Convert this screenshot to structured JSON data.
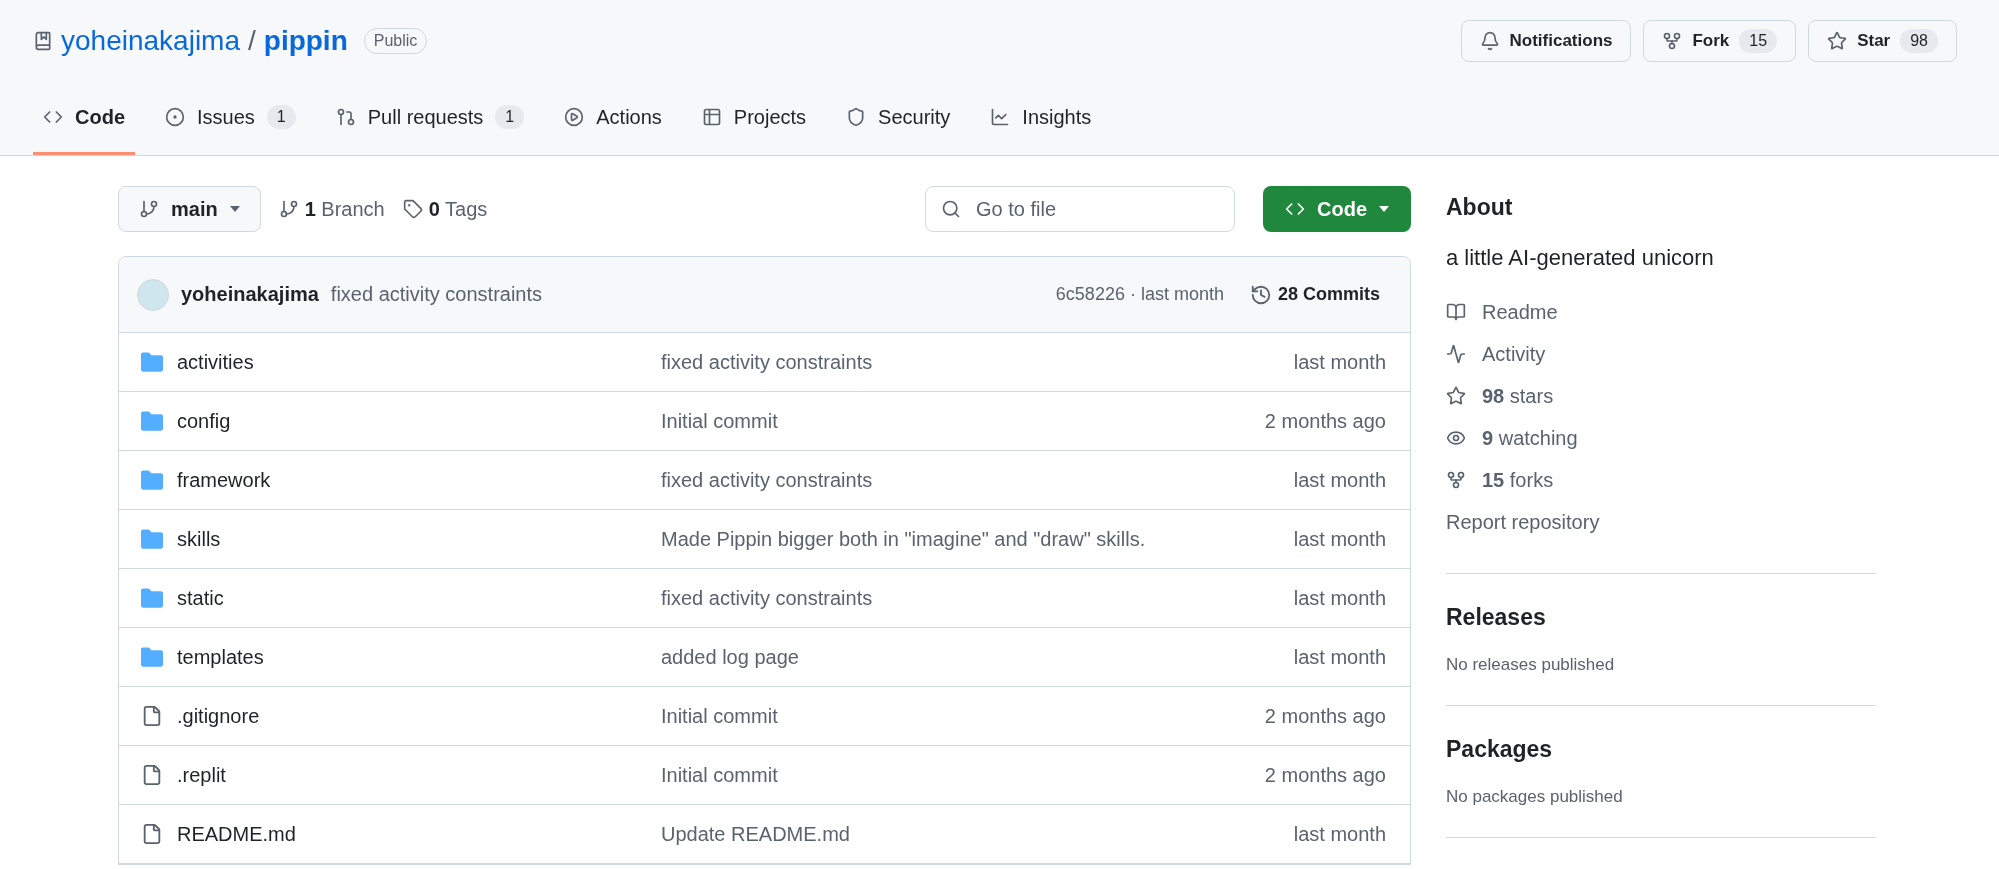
{
  "repo": {
    "owner": "yoheinakajima",
    "separator": "/",
    "name": "pippin",
    "visibility": "Public"
  },
  "header_actions": [
    {
      "kind": "notifications",
      "label": "Notifications"
    },
    {
      "kind": "fork",
      "label": "Fork",
      "count": "15"
    },
    {
      "kind": "star",
      "label": "Star",
      "count": "98"
    }
  ],
  "tabs": [
    {
      "kind": "code",
      "label": "Code",
      "selected": true
    },
    {
      "kind": "issues",
      "label": "Issues",
      "count": "1",
      "selected": false
    },
    {
      "kind": "pulls",
      "label": "Pull requests",
      "count": "1",
      "selected": false
    },
    {
      "kind": "actions",
      "label": "Actions",
      "selected": false
    },
    {
      "kind": "projects",
      "label": "Projects",
      "selected": false
    },
    {
      "kind": "security",
      "label": "Security",
      "selected": false
    },
    {
      "kind": "insights",
      "label": "Insights",
      "selected": false
    }
  ],
  "toolbar": {
    "branch": "main",
    "branches": "**1** Branch",
    "tags": "**0** Tags",
    "search_placeholder": "Go to file",
    "code_button": "Code"
  },
  "latest_commit": {
    "author": "yoheinakajima",
    "message": "fixed activity constraints",
    "hash_time": "6c58226 · last month",
    "commits": "28 Commits"
  },
  "files": [
    {
      "kind": "folder",
      "name": "activities",
      "message": "fixed activity constraints",
      "time": "last month"
    },
    {
      "kind": "folder",
      "name": "config",
      "message": "Initial commit",
      "time": "2 months ago"
    },
    {
      "kind": "folder",
      "name": "framework",
      "message": "fixed activity constraints",
      "time": "last month"
    },
    {
      "kind": "folder",
      "name": "skills",
      "message": "Made Pippin bigger both in \"imagine\" and \"draw\" skills.",
      "time": "last month"
    },
    {
      "kind": "folder",
      "name": "static",
      "message": "fixed activity constraints",
      "time": "last month"
    },
    {
      "kind": "folder",
      "name": "templates",
      "message": "added log page",
      "time": "last month"
    },
    {
      "kind": "file",
      "name": ".gitignore",
      "message": "Initial commit",
      "time": "2 months ago"
    },
    {
      "kind": "file",
      "name": ".replit",
      "message": "Initial commit",
      "time": "2 months ago"
    },
    {
      "kind": "file",
      "name": "README.md",
      "message": "Update README.md",
      "time": "last month"
    }
  ],
  "about": {
    "title": "About",
    "description": "a little AI-generated unicorn",
    "links": [
      {
        "kind": "readme",
        "text": "Readme"
      },
      {
        "kind": "activity",
        "text": "Activity"
      },
      {
        "kind": "stars",
        "text": "**98** stars"
      },
      {
        "kind": "watching",
        "text": "**9** watching"
      },
      {
        "kind": "forks",
        "text": "**15** forks"
      }
    ],
    "report": "Report repository"
  },
  "releases": {
    "title": "Releases",
    "text": "No releases published"
  },
  "packages": {
    "title": "Packages",
    "text": "No packages published"
  }
}
